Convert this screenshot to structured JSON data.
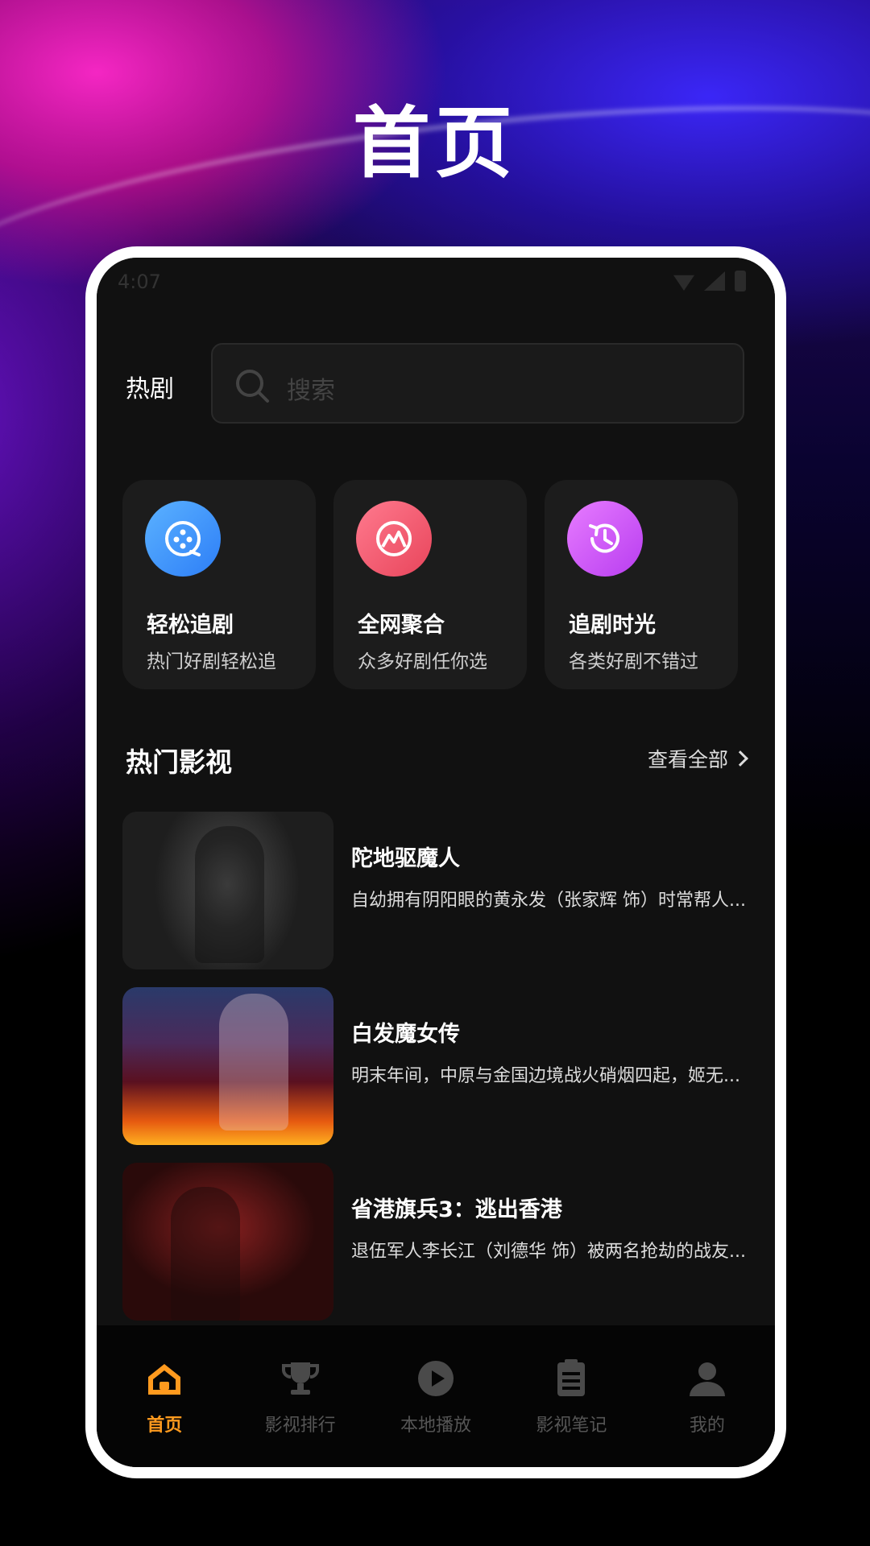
{
  "promo": {
    "title": "首页"
  },
  "status": {
    "time": "4:07"
  },
  "header": {
    "title": "热剧",
    "search_placeholder": "搜索"
  },
  "features": [
    {
      "title": "轻松追剧",
      "subtitle": "热门好剧轻松追",
      "icon": "film-reel-icon",
      "color": "#3b8cf9"
    },
    {
      "title": "全网聚合",
      "subtitle": "众多好剧任你选",
      "icon": "mountain-icon",
      "color": "#ef5a6e"
    },
    {
      "title": "追剧时光",
      "subtitle": "各类好剧不错过",
      "icon": "clock-icon",
      "color": "#c955f3"
    }
  ],
  "section": {
    "title": "热门影视",
    "view_all": "查看全部"
  },
  "movies": [
    {
      "title": "陀地驱魔人",
      "desc": "自幼拥有阴阳眼的黄永发（张家辉 饰）时常帮人..."
    },
    {
      "title": "白发魔女传",
      "desc": "明末年间，中原与金国边境战火硝烟四起，姬无..."
    },
    {
      "title": "省港旗兵3：逃出香港",
      "desc": "退伍军人李长江（刘德华 饰）被两名抢劫的战友..."
    }
  ],
  "tabs": [
    {
      "label": "首页",
      "icon": "home-icon",
      "active": true
    },
    {
      "label": "影视排行",
      "icon": "trophy-icon",
      "active": false
    },
    {
      "label": "本地播放",
      "icon": "play-icon",
      "active": false
    },
    {
      "label": "影视笔记",
      "icon": "notes-icon",
      "active": false
    },
    {
      "label": "我的",
      "icon": "user-icon",
      "active": false
    }
  ],
  "colors": {
    "accent": "#ff9a1e",
    "background": "#111111",
    "card": "#1c1c1c"
  }
}
